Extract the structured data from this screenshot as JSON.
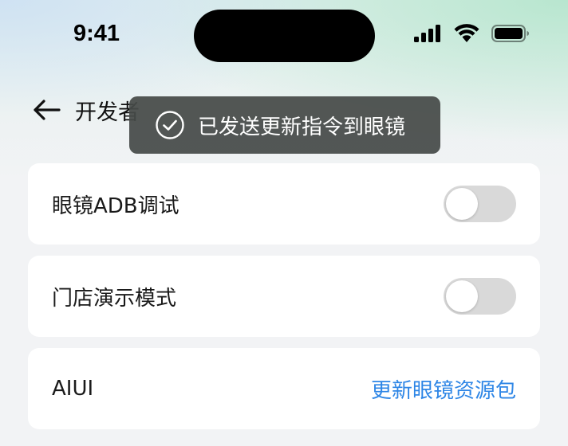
{
  "status_bar": {
    "time": "9:41",
    "icons": [
      "signal-icon",
      "wifi-icon",
      "battery-icon"
    ]
  },
  "header": {
    "back_icon": "arrow-left-icon",
    "title": "开发者"
  },
  "toast": {
    "icon": "check-circle-icon",
    "message": "已发送更新指令到眼镜"
  },
  "settings": {
    "adb_debug": {
      "label": "眼镜ADB调试",
      "enabled": false
    },
    "store_demo": {
      "label": "门店演示模式",
      "enabled": false
    },
    "aiui": {
      "label": "AIUI",
      "action_label": "更新眼镜资源包"
    }
  },
  "colors": {
    "link": "#2e86e6",
    "toggle_off": "#d9d9d9",
    "toast_bg": "#464a48",
    "page_bg": "#f2f3f5"
  }
}
